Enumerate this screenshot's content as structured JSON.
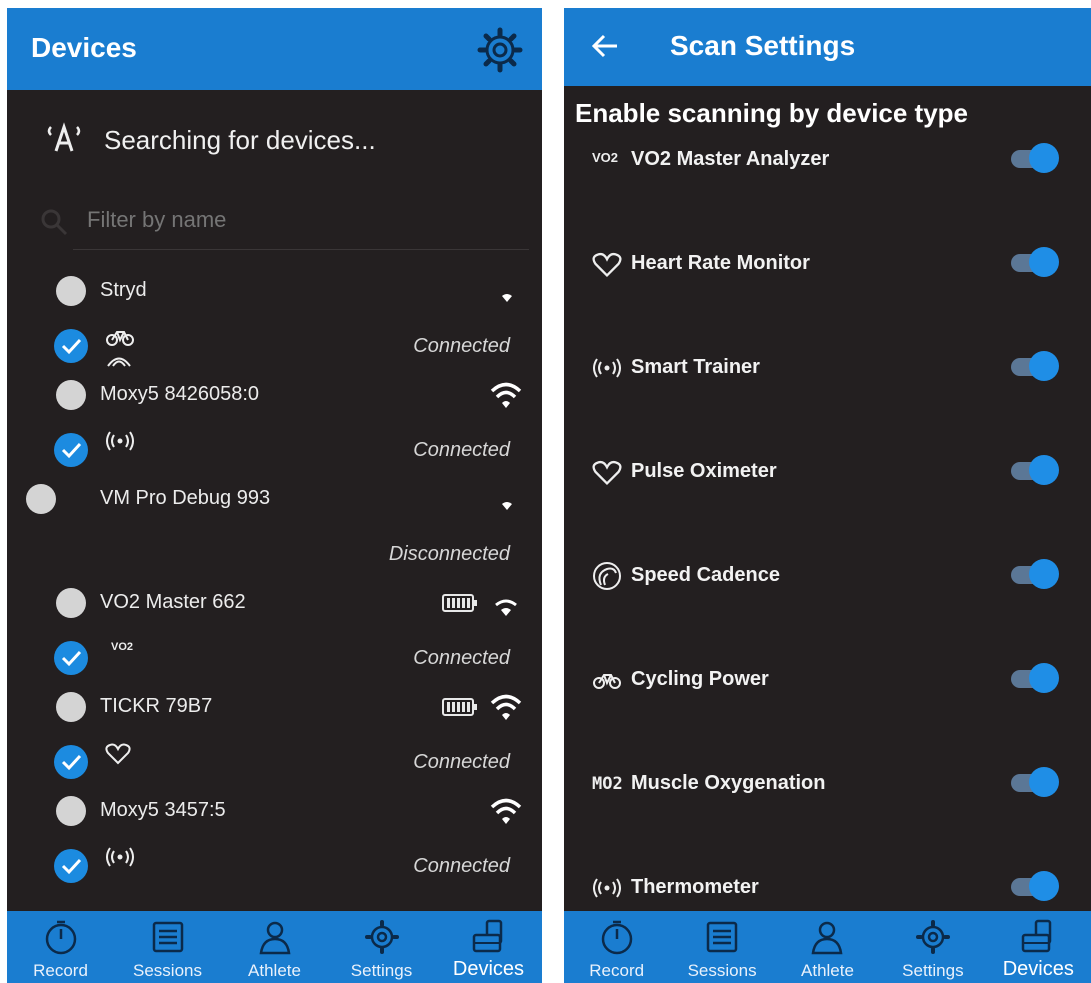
{
  "left": {
    "title": "Devices",
    "search_status": "Searching for devices...",
    "filter_placeholder": "Filter by name",
    "devices": [
      {
        "name": "Stryd",
        "status": "Connected",
        "signal": "weak",
        "sub_icons": [
          "bike-icon",
          "speed-icon"
        ]
      },
      {
        "name": "Moxy5 8426058:0",
        "status": "Connected",
        "signal": "strong",
        "sub_icons": [
          "sensor-icon"
        ]
      },
      {
        "name": "VM Pro Debug 993",
        "status": "Disconnected",
        "signal": "weak",
        "sub_icons": []
      },
      {
        "name": "VO2 Master 662",
        "status": "Connected",
        "signal": "medium",
        "battery": true,
        "sub_text": "VO2",
        "sub_icons": [
          "vo2-icon"
        ]
      },
      {
        "name": "TICKR 79B7",
        "status": "Connected",
        "signal": "strong",
        "battery": true,
        "sub_icons": [
          "heart-icon"
        ]
      },
      {
        "name": "Moxy5 3457:5",
        "status": "Connected",
        "signal": "strong",
        "sub_icons": [
          "sensor-icon"
        ]
      }
    ]
  },
  "right": {
    "title": "Scan Settings",
    "section_heading": "Enable scanning by device type",
    "device_types": [
      {
        "label": "VO2 Master Analyzer",
        "icon": "vo2-icon",
        "icon_text": "VO2",
        "enabled": true
      },
      {
        "label": "Heart Rate Monitor",
        "icon": "heart-icon",
        "enabled": true
      },
      {
        "label": "Smart Trainer",
        "icon": "sensor-icon",
        "enabled": true
      },
      {
        "label": "Pulse Oximeter",
        "icon": "heart-icon",
        "enabled": true
      },
      {
        "label": "Speed Cadence",
        "icon": "speed-icon",
        "enabled": true
      },
      {
        "label": "Cycling Power",
        "icon": "bike-icon",
        "enabled": true
      },
      {
        "label": "Muscle Oxygenation",
        "icon": "mo2-icon",
        "icon_text": "MO2",
        "enabled": true
      },
      {
        "label": "Thermometer",
        "icon": "sensor-icon",
        "enabled": true
      }
    ]
  },
  "nav": {
    "items": [
      "Record",
      "Sessions",
      "Athlete",
      "Settings",
      "Devices"
    ],
    "active": "Devices"
  },
  "colors": {
    "primary": "#1a7dd0",
    "background": "#231f20",
    "toggle_on": "#1f8ee6",
    "check": "#1c8be0"
  }
}
